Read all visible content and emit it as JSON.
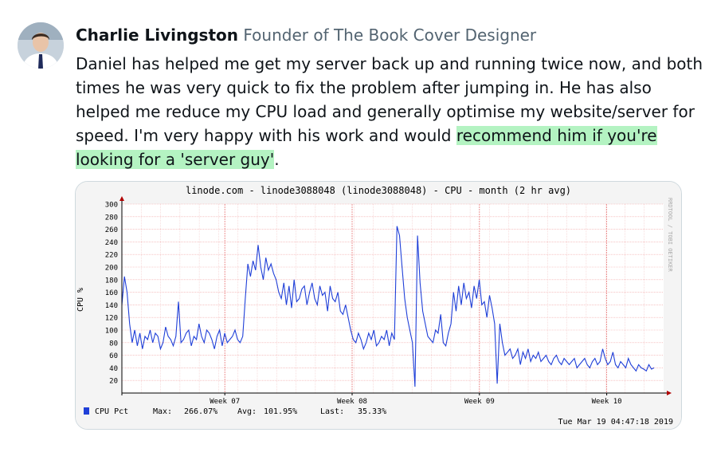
{
  "author": {
    "name": "Charlie Livingston",
    "title": "Founder of The Book Cover Designer",
    "avatar_icon": "person-avatar-icon"
  },
  "testimonial": {
    "text_before": "Daniel has helped me get my server back up and running twice now, and both times he was very quick to fix the problem after jumping in. He has also helped me reduce my CPU load and generally optimise my website/server for speed. I'm very happy with his work and would ",
    "text_highlight": "recommend him if you're looking for a 'server guy'",
    "text_after": ".",
    "highlight_color": "#b4f3c2"
  },
  "chart_data": {
    "type": "line",
    "title": "linode.com - linode3088048 (linode3088048) - CPU - month (2 hr avg)",
    "ylabel": "CPU %",
    "side_label": "RRDTOOL / TOBI OETIKER",
    "ylim": [
      0,
      300
    ],
    "yticks": [
      20,
      40,
      60,
      80,
      100,
      120,
      140,
      160,
      180,
      200,
      220,
      240,
      260,
      280,
      300
    ],
    "xticks": [
      "Week 07",
      "Week 08",
      "Week 09",
      "Week 10"
    ],
    "grid": true,
    "line_color": "#1f3fd8",
    "legend": {
      "label": "CPU Pct",
      "max_label": "Max:",
      "max_value": "266.07%",
      "avg_label": "Avg:",
      "avg_value": "101.95%",
      "last_label": "Last:",
      "last_value": "35.33%"
    },
    "timestamp": "Tue Mar 19 04:47:18 2019",
    "series": [
      {
        "values": [
          140,
          185,
          160,
          110,
          80,
          100,
          75,
          95,
          70,
          90,
          85,
          100,
          80,
          95,
          90,
          70,
          80,
          105,
          90,
          85,
          75,
          90,
          145,
          80,
          85,
          95,
          100,
          75,
          90,
          85,
          110,
          90,
          80,
          100,
          95,
          85,
          70,
          90,
          100,
          75,
          95,
          80,
          85,
          90,
          100,
          85,
          80,
          90,
          150,
          205,
          185,
          210,
          195,
          235,
          200,
          180,
          215,
          195,
          205,
          190,
          180,
          160,
          150,
          175,
          140,
          170,
          135,
          180,
          145,
          150,
          165,
          170,
          140,
          160,
          175,
          150,
          140,
          170,
          155,
          160,
          130,
          170,
          150,
          145,
          160,
          130,
          125,
          140,
          120,
          100,
          85,
          80,
          95,
          85,
          70,
          80,
          95,
          85,
          100,
          75,
          80,
          90,
          85,
          100,
          75,
          95,
          85,
          265,
          250,
          200,
          150,
          120,
          100,
          80,
          10,
          250,
          175,
          130,
          110,
          90,
          85,
          80,
          100,
          95,
          125,
          80,
          75,
          95,
          110,
          160,
          130,
          170,
          140,
          175,
          150,
          160,
          135,
          170,
          150,
          180,
          140,
          145,
          120,
          155,
          135,
          110,
          15,
          110,
          80,
          60,
          65,
          70,
          55,
          60,
          70,
          45,
          65,
          55,
          70,
          50,
          60,
          55,
          65,
          50,
          55,
          60,
          50,
          45,
          55,
          60,
          50,
          45,
          55,
          50,
          45,
          50,
          55,
          40,
          45,
          50,
          55,
          45,
          40,
          50,
          55,
          45,
          50,
          70,
          55,
          45,
          50,
          65,
          45,
          40,
          50,
          45,
          40,
          55,
          45,
          40,
          35,
          45,
          40,
          38,
          35,
          45,
          38,
          40
        ]
      }
    ]
  }
}
